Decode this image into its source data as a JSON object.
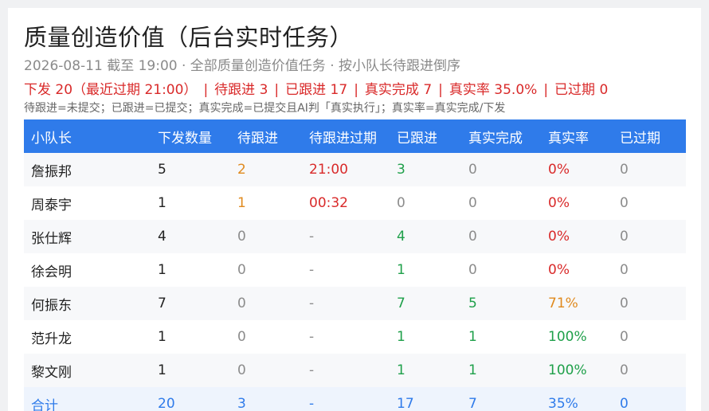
{
  "header": {
    "title": "质量创造价值（后台实时任务）",
    "subtitle": "2026-08-11 截至 19:00 · 全部质量创造价值任务 · 按小队长待跟进倒序"
  },
  "summary": {
    "issued": "下发 20（最近过期 21:00）",
    "pending": "待跟进 3",
    "followed": "已跟进 17",
    "completed": "真实完成 7",
    "rate": "真实率 35.0%",
    "expired": "已过期 0",
    "separator": "|"
  },
  "legend": "待跟进=未提交；已跟进=已提交；真实完成=已提交且AI判「真实执行」；真实率=真实完成/下发",
  "table": {
    "headers": [
      "小队长",
      "下发数量",
      "待跟进",
      "待跟进过期",
      "已跟进",
      "真实完成",
      "真实率",
      "已过期"
    ],
    "rows": [
      {
        "leader": "詹振邦",
        "issued": "5",
        "pending": "2",
        "pending_expire": "21:00",
        "followed": "3",
        "completed": "0",
        "rate": "0%",
        "expired": "0"
      },
      {
        "leader": "周泰宇",
        "issued": "1",
        "pending": "1",
        "pending_expire": "00:32",
        "followed": "0",
        "completed": "0",
        "rate": "0%",
        "expired": "0"
      },
      {
        "leader": "张仕辉",
        "issued": "4",
        "pending": "0",
        "pending_expire": "-",
        "followed": "4",
        "completed": "0",
        "rate": "0%",
        "expired": "0"
      },
      {
        "leader": "徐会明",
        "issued": "1",
        "pending": "0",
        "pending_expire": "-",
        "followed": "1",
        "completed": "0",
        "rate": "0%",
        "expired": "0"
      },
      {
        "leader": "何振东",
        "issued": "7",
        "pending": "0",
        "pending_expire": "-",
        "followed": "7",
        "completed": "5",
        "rate": "71%",
        "expired": "0"
      },
      {
        "leader": "范升龙",
        "issued": "1",
        "pending": "0",
        "pending_expire": "-",
        "followed": "1",
        "completed": "1",
        "rate": "100%",
        "expired": "0"
      },
      {
        "leader": "黎文刚",
        "issued": "1",
        "pending": "0",
        "pending_expire": "-",
        "followed": "1",
        "completed": "1",
        "rate": "100%",
        "expired": "0"
      }
    ],
    "total": {
      "leader": "合计",
      "issued": "20",
      "pending": "3",
      "pending_expire": "-",
      "followed": "17",
      "completed": "7",
      "rate": "35%",
      "expired": "0"
    }
  },
  "colors": {
    "header_bg": "#2f7bea",
    "red": "#d92a2a",
    "orange": "#e08a1e",
    "green": "#1fa04a",
    "gray": "#8c8c8c",
    "blue": "#2f7bea"
  }
}
